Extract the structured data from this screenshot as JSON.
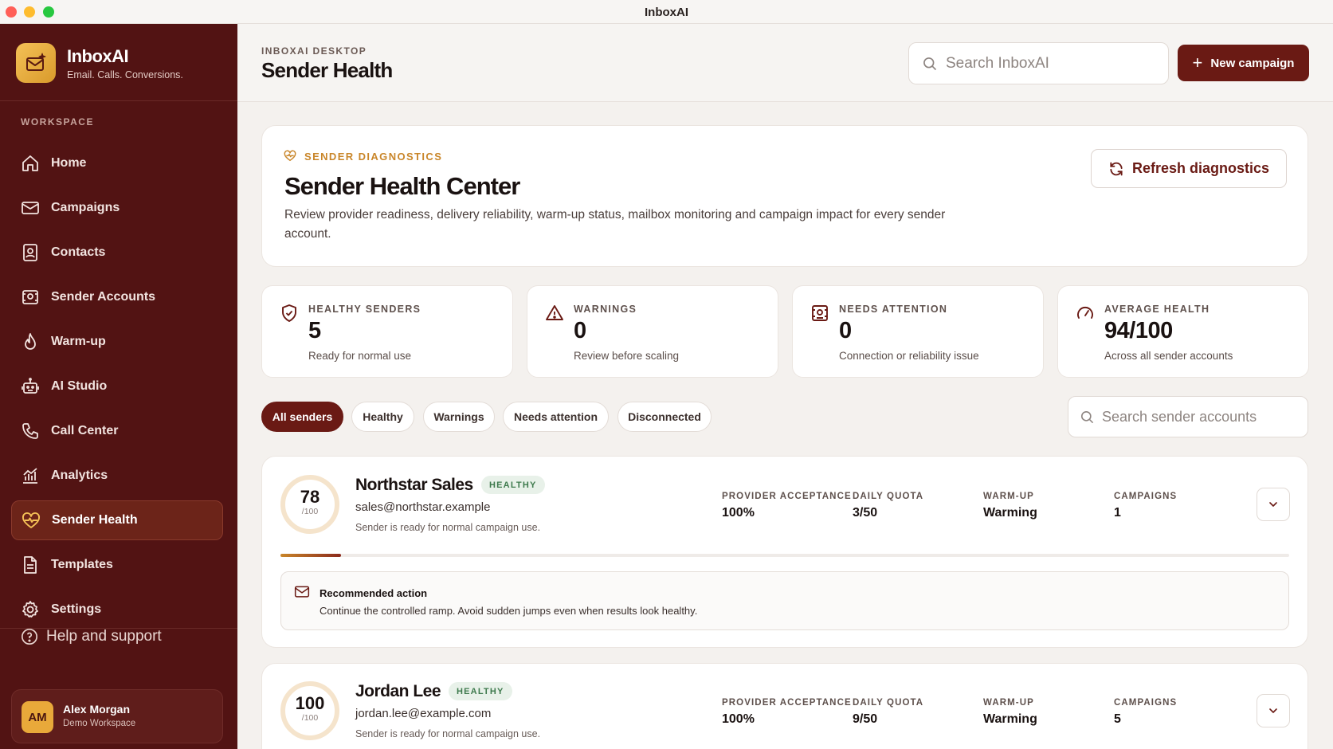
{
  "window": {
    "title": "InboxAI"
  },
  "brand": {
    "name": "InboxAI",
    "tagline": "Email. Calls. Conversions."
  },
  "sidebar": {
    "section_label": "WORKSPACE",
    "items": [
      {
        "label": "Home",
        "icon": "home-icon"
      },
      {
        "label": "Campaigns",
        "icon": "mail-icon"
      },
      {
        "label": "Contacts",
        "icon": "contacts-icon"
      },
      {
        "label": "Sender Accounts",
        "icon": "sender-accounts-icon"
      },
      {
        "label": "Warm-up",
        "icon": "flame-icon"
      },
      {
        "label": "AI Studio",
        "icon": "robot-icon"
      },
      {
        "label": "Call Center",
        "icon": "phone-icon"
      },
      {
        "label": "Analytics",
        "icon": "analytics-icon"
      },
      {
        "label": "Sender Health",
        "icon": "heart-pulse-icon",
        "active": true
      },
      {
        "label": "Templates",
        "icon": "document-icon"
      },
      {
        "label": "Settings",
        "icon": "gear-icon"
      }
    ],
    "help_label": "Help and support",
    "user": {
      "initials": "AM",
      "name": "Alex Morgan",
      "workspace": "Demo Workspace"
    }
  },
  "header": {
    "breadcrumb": "INBOXAI DESKTOP",
    "title": "Sender Health",
    "search_placeholder": "Search InboxAI",
    "new_campaign_label": "New campaign"
  },
  "diagnostics": {
    "eyebrow": "SENDER DIAGNOSTICS",
    "title": "Sender Health Center",
    "description": "Review provider readiness, delivery reliability, warm-up status, mailbox monitoring and campaign impact for every sender account.",
    "refresh_label": "Refresh diagnostics"
  },
  "stats": [
    {
      "label": "HEALTHY SENDERS",
      "value": "5",
      "sub": "Ready for normal use",
      "icon": "shield-check-icon"
    },
    {
      "label": "WARNINGS",
      "value": "0",
      "sub": "Review before scaling",
      "icon": "warning-triangle-icon"
    },
    {
      "label": "NEEDS ATTENTION",
      "value": "0",
      "sub": "Connection or reliability issue",
      "icon": "attention-icon"
    },
    {
      "label": "AVERAGE HEALTH",
      "value": "94/100",
      "sub": "Across all sender accounts",
      "icon": "gauge-icon"
    }
  ],
  "filters": {
    "chips": [
      "All senders",
      "Healthy",
      "Warnings",
      "Needs attention",
      "Disconnected"
    ],
    "active": "All senders",
    "search_placeholder": "Search sender accounts"
  },
  "metric_labels": {
    "acceptance": "PROVIDER ACCEPTANCE",
    "quota": "DAILY QUOTA",
    "warmup": "WARM-UP",
    "campaigns": "CAMPAIGNS"
  },
  "senders": [
    {
      "score": "78",
      "score_max": "/100",
      "name": "Northstar Sales",
      "status": "HEALTHY",
      "email": "sales@northstar.example",
      "note": "Sender is ready for normal campaign use.",
      "acceptance": "100%",
      "quota": "3/50",
      "warmup": "Warming",
      "campaigns": "1",
      "quota_progress": 0.06,
      "recommendation": {
        "title": "Recommended action",
        "text": "Continue the controlled ramp. Avoid sudden jumps even when results look healthy."
      }
    },
    {
      "score": "100",
      "score_max": "/100",
      "name": "Jordan Lee",
      "status": "HEALTHY",
      "email": "jordan.lee@example.com",
      "note": "Sender is ready for normal campaign use.",
      "acceptance": "100%",
      "quota": "9/50",
      "warmup": "Warming",
      "campaigns": "5"
    }
  ],
  "colors": {
    "sidebar_bg": "#521313",
    "accent": "#6a1a14",
    "gold": "#c9862a",
    "healthy_badge_bg": "#e8f1e9",
    "healthy_badge_text": "#3e7a4d"
  }
}
